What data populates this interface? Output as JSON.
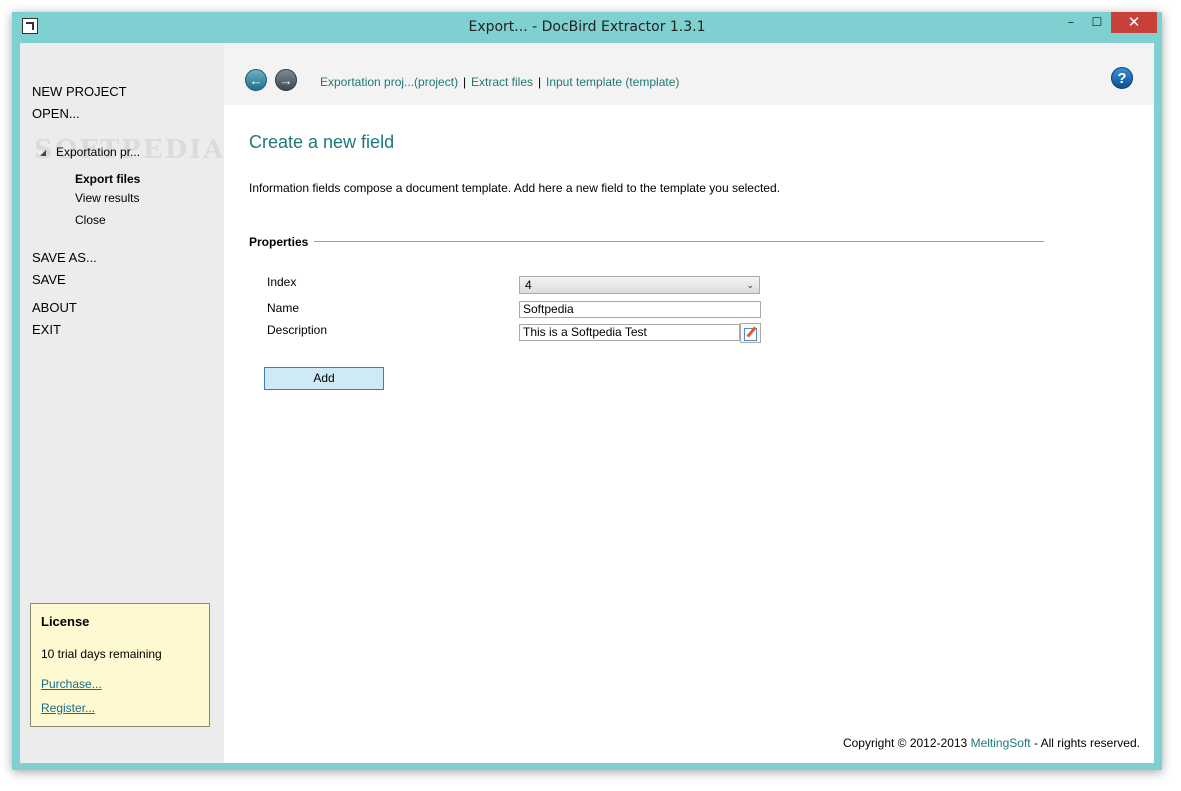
{
  "window": {
    "title": "Export... - DocBird Extractor 1.3.1",
    "controls": {
      "minimize": "–",
      "maximize": "☐",
      "close": "✕"
    }
  },
  "sidebar": {
    "menu": {
      "new_project": "NEW PROJECT",
      "open": "OPEN...",
      "save_as": "SAVE AS...",
      "save": "SAVE",
      "about": "ABOUT",
      "exit": "EXIT"
    },
    "tree": {
      "toggle": "◢",
      "node": "Exportation pr...",
      "children": [
        "Export files",
        "View results",
        "Close"
      ]
    },
    "license": {
      "title": "License",
      "days": "10 trial days remaining",
      "purchase": "Purchase...",
      "register": "Register..."
    }
  },
  "topbar": {
    "back_icon": "←",
    "forward_icon": "→",
    "breadcrumbs": [
      "Exportation proj...(project)",
      "Extract files",
      "Input template (template)"
    ],
    "separator": "|",
    "help_icon": "?"
  },
  "main": {
    "title": "Create a new field",
    "intro": "Information fields compose a document template. Add here a new field to the template you selected.",
    "section": "Properties",
    "fields": {
      "index_label": "Index",
      "index_value": "4",
      "name_label": "Name",
      "name_value": "Softpedia",
      "description_label": "Description",
      "description_value": "This is a Softpedia Test"
    },
    "add_button": "Add"
  },
  "footer": {
    "copyright": "Copyright © 2012-2013",
    "company": "MeltingSoft",
    "rights": "- All rights reserved."
  },
  "colors": {
    "frame": "#7fd0d0",
    "accent": "#1f7878",
    "close_button": "#c7413a",
    "license_bg": "#fff9d2",
    "add_button_bg": "#cfeaf6"
  }
}
